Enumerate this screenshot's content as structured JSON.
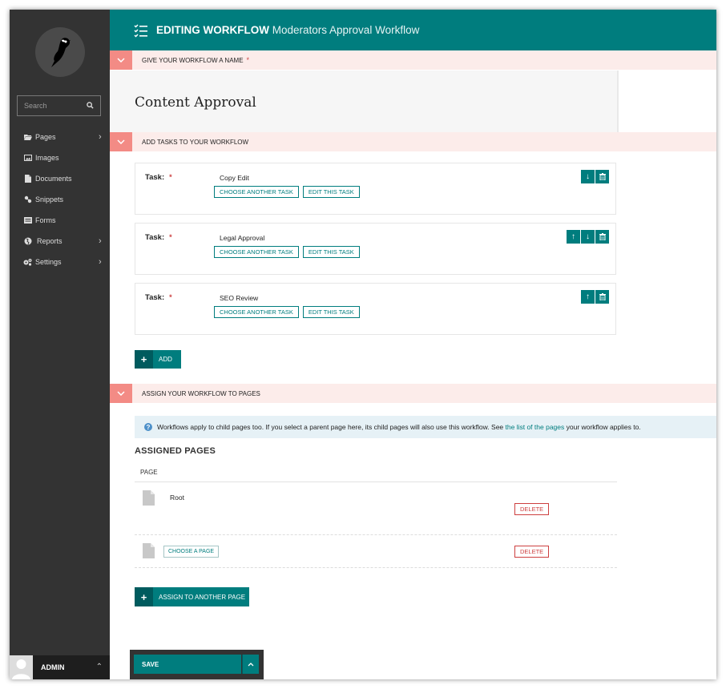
{
  "sidebar": {
    "search_placeholder": "Search",
    "items": [
      {
        "label": "Pages",
        "icon": "folder-open-icon",
        "has_submenu": true
      },
      {
        "label": "Images",
        "icon": "image-icon",
        "has_submenu": false
      },
      {
        "label": "Documents",
        "icon": "document-icon",
        "has_submenu": false
      },
      {
        "label": "Snippets",
        "icon": "snippet-icon",
        "has_submenu": false
      },
      {
        "label": "Forms",
        "icon": "form-icon",
        "has_submenu": false
      },
      {
        "label": "Reports",
        "icon": "globe-icon",
        "has_submenu": true
      },
      {
        "label": "Settings",
        "icon": "cogs-icon",
        "has_submenu": true
      }
    ],
    "account_name": "ADMIN"
  },
  "header": {
    "action": "EDITING WORKFLOW",
    "subtitle": "Moderators Approval Workflow"
  },
  "sections": {
    "name": {
      "label": "GIVE YOUR WORKFLOW A NAME",
      "required": "*",
      "value": "Content Approval"
    },
    "tasks": {
      "label": "ADD TASKS TO YOUR WORKFLOW"
    },
    "pages": {
      "label": "ASSIGN YOUR WORKFLOW TO PAGES"
    }
  },
  "tasks": [
    {
      "label": "Task:",
      "required": "*",
      "name": "Copy Edit",
      "choose_label": "CHOOSE ANOTHER TASK",
      "edit_label": "EDIT THIS TASK"
    },
    {
      "label": "Task:",
      "required": "*",
      "name": "Legal Approval",
      "choose_label": "CHOOSE ANOTHER TASK",
      "edit_label": "EDIT THIS TASK"
    },
    {
      "label": "Task:",
      "required": "*",
      "name": "SEO Review",
      "choose_label": "CHOOSE ANOTHER TASK",
      "edit_label": "EDIT THIS TASK"
    }
  ],
  "add_label": "ADD",
  "info": {
    "text_before": "Workflows apply to child pages too. If you select a parent page here, its child pages will also use this workflow. See",
    "link_text": "the list of the pages",
    "text_after": "your workflow applies to."
  },
  "assigned": {
    "title": "ASSIGNED PAGES",
    "column_header": "PAGE",
    "rows": [
      {
        "page": "Root",
        "delete_label": "DELETE"
      }
    ],
    "new_row": {
      "choose_label": "CHOOSE A PAGE",
      "delete_label": "DELETE"
    },
    "assign_label": "ASSIGN TO ANOTHER PAGE"
  },
  "footer": {
    "save_label": "SAVE"
  },
  "colors": {
    "teal": "#007d7e",
    "dark_teal": "#005b5e",
    "sidebar": "#333333",
    "section_bg": "#fcecea",
    "toggle": "#f38b85",
    "required": "#cd4444"
  }
}
